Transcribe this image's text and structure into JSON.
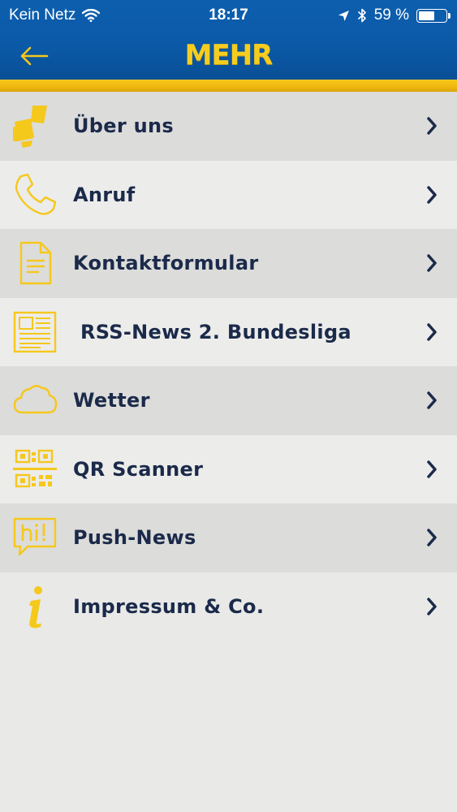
{
  "status_bar": {
    "carrier": "Kein Netz",
    "time": "18:17",
    "battery_percent": "59 %",
    "battery_level": 0.59
  },
  "nav": {
    "title": "MEHR",
    "back_icon": "arrow-left-icon"
  },
  "colors": {
    "header_blue": "#0b5aa8",
    "accent_yellow": "#f5c81c",
    "label_navy": "#1b2a4a"
  },
  "menu": {
    "items": [
      {
        "label": "Über uns",
        "icon": "megaphone-icon"
      },
      {
        "label": "Anruf",
        "icon": "phone-icon"
      },
      {
        "label": "Kontaktformular",
        "icon": "document-icon"
      },
      {
        "label": "RSS-News 2. Bundesliga",
        "icon": "newspaper-icon"
      },
      {
        "label": "Wetter",
        "icon": "cloud-icon"
      },
      {
        "label": "QR Scanner",
        "icon": "qr-code-icon"
      },
      {
        "label": "Push-News",
        "icon": "speech-bubble-icon"
      },
      {
        "label": "Impressum & Co.",
        "icon": "info-icon"
      }
    ]
  }
}
